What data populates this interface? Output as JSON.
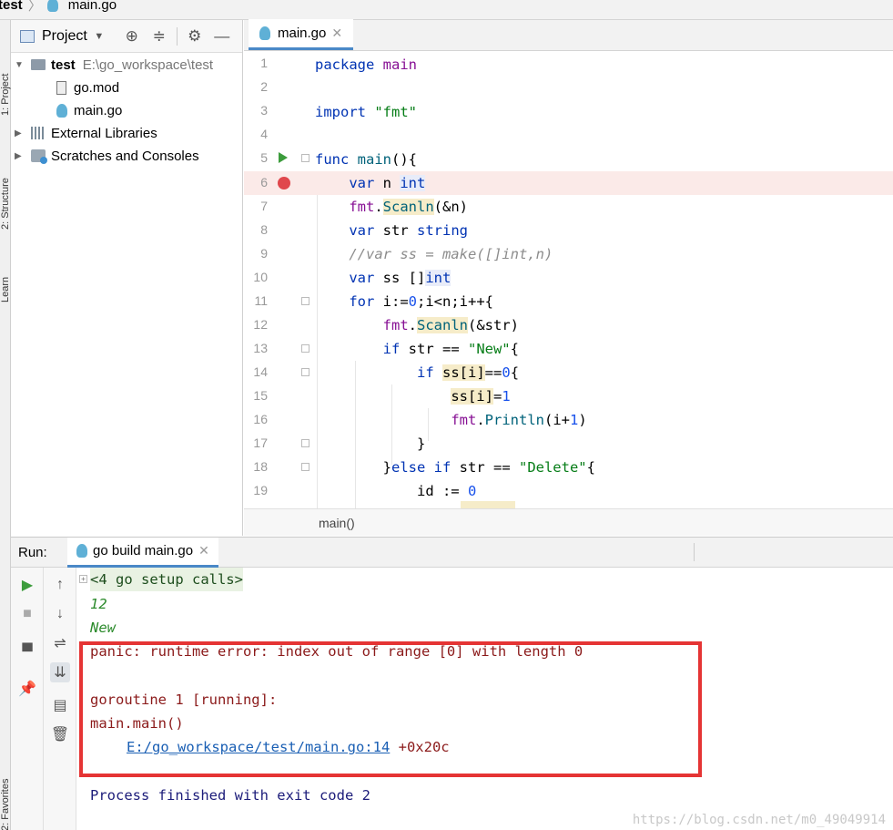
{
  "breadcrumb": {
    "project": "test",
    "file": "main.go"
  },
  "left_strip": {
    "tabs": [
      "1: Project",
      "2: Structure",
      "Learn",
      "2: Favorites"
    ]
  },
  "project_panel": {
    "title": "Project",
    "tree": [
      {
        "label": "test",
        "path": "E:\\go_workspace\\test"
      },
      {
        "label": "go.mod"
      },
      {
        "label": "main.go"
      },
      {
        "label": "External Libraries"
      },
      {
        "label": "Scratches and Consoles"
      }
    ]
  },
  "editor": {
    "tab": "main.go",
    "status": "main()",
    "line_numbers": [
      "1",
      "2",
      "3",
      "4",
      "5",
      "6",
      "7",
      "8",
      "9",
      "10",
      "11",
      "12",
      "13",
      "14",
      "15",
      "16",
      "17",
      "18",
      "19"
    ]
  },
  "run": {
    "label": "Run:",
    "tab": "go build main.go",
    "console": {
      "setup": "<4 go setup calls>",
      "input_1": "12",
      "input_2": "New",
      "panic": "panic: runtime error: index out of range [0] with length 0",
      "goroutine": "goroutine 1 [running]:",
      "frame": "main.main()",
      "link": "E:/go_workspace/test/main.go:14",
      "offset": "+0x20c",
      "finished": "Process finished with exit code 2"
    }
  },
  "watermark": "https://blog.csdn.net/m0_49049914",
  "colors": {
    "keyword": "#0033b3",
    "string": "#067d17",
    "number": "#1750eb",
    "error_box": "#e53434",
    "breakpoint": "#e0474c"
  }
}
